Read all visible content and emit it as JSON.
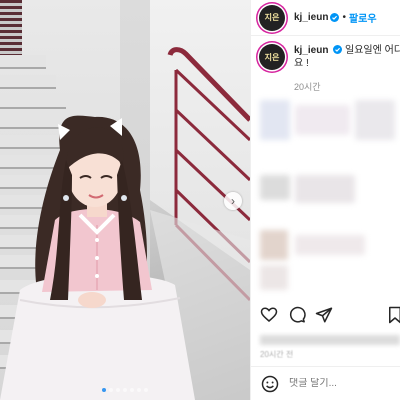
{
  "header": {
    "avatar_text": "지은",
    "username": "kj_ieun",
    "dot": "•",
    "follow_label": "팔로우"
  },
  "caption": {
    "username": "kj_ieun",
    "text_line1": "일요일엔 어디가",
    "text_line2": "요 !",
    "time": "20시간"
  },
  "footer": {
    "time": "20시간 전",
    "comment_placeholder": "댓글 달기..."
  },
  "media": {
    "slide_count": 7,
    "active_slide": 1
  },
  "colors": {
    "accent_blue": "#0095f6",
    "rail": "#8c2a3c",
    "avatar_ring": "#d6249f"
  },
  "icons": [
    "verified-badge-icon",
    "heart-icon",
    "comment-icon",
    "share-icon",
    "bookmark-icon",
    "emoji-icon",
    "chevron-right-icon"
  ]
}
